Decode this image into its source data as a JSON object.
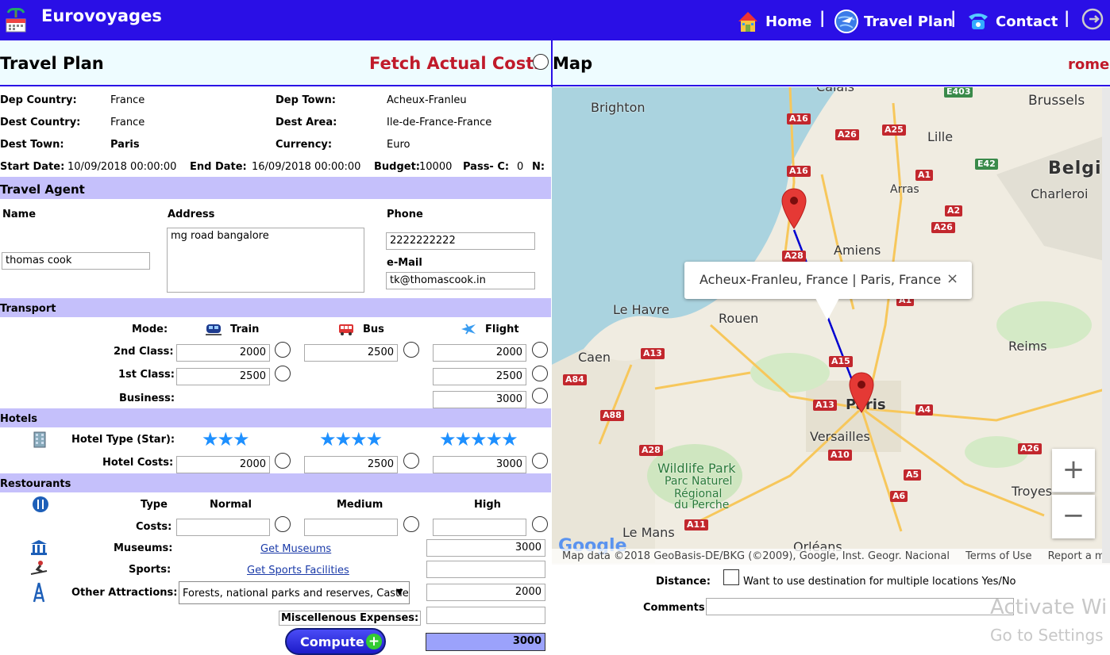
{
  "brand": "Eurovoyages",
  "nav": {
    "home": "Home",
    "travel_plan": "Travel Plan",
    "contact": "Contact",
    "sep": "|"
  },
  "left_head": {
    "title": "Travel Plan",
    "fetch": "Fetch Actual Costs"
  },
  "right_head": {
    "title": "Map",
    "error": "rome"
  },
  "trip": {
    "dep_country_label": "Dep Country:",
    "dep_country": "France",
    "dep_town_label": "Dep Town:",
    "dep_town": "Acheux-Franleu",
    "dest_country_label": "Dest Country:",
    "dest_country": "France",
    "dest_area_label": "Dest Area:",
    "dest_area": "Ile-de-France-France",
    "dest_town_label": "Dest Town:",
    "dest_town": "Paris",
    "currency_label": "Currency:",
    "currency": "Euro",
    "start_label": "Start Date:",
    "start": "10/09/2018 00:00:00",
    "end_label": "End Date:",
    "end": "16/09/2018 00:00:00",
    "budget_label": "Budget:",
    "budget": "10000",
    "pass_label": "Pass- C:",
    "pass": "0",
    "n_label": "N:"
  },
  "agent": {
    "section": "Travel Agent",
    "name_label": "Name",
    "name": "thomas cook",
    "address_label": "Address",
    "address": "mg road bangalore",
    "phone_label": "Phone",
    "phone": "2222222222",
    "email_label": "e-Mail",
    "email": "tk@thomascook.in"
  },
  "transport": {
    "section": "Transport",
    "mode_label": "Mode:",
    "train": "Train",
    "bus": "Bus",
    "flight": "Flight",
    "second_label": "2nd Class:",
    "first_label": "1st Class:",
    "business_label": "Business:",
    "train_2nd": "2000",
    "bus_2nd": "2500",
    "flight_2nd": "2000",
    "train_1st": "2500",
    "flight_1st": "2500",
    "flight_business": "3000"
  },
  "hotels": {
    "section": "Hotels",
    "type_label": "Hotel Type (Star):",
    "costs_label": "Hotel Costs:",
    "stars3": "★★★",
    "stars4": "★★★★",
    "stars5": "★★★★★",
    "cost3": "2000",
    "cost4": "2500",
    "cost5": "3000"
  },
  "restaurants": {
    "section": "Restourants",
    "type_label": "Type",
    "normal": "Normal",
    "medium": "Medium",
    "high": "High",
    "costs_label": "Costs:",
    "museums_label": "Museums:",
    "museums_link": "Get Museums",
    "museums_cost": "3000",
    "sports_label": "Sports:",
    "sports_link": "Get Sports Facilities",
    "other_label": "Other Attractions:",
    "other_value": "Forests, national parks and reserves, Castles",
    "other_cost": "2000",
    "misc_label": "Miscellenous Expenses:",
    "compute": "Compute",
    "total": "3000"
  },
  "map": {
    "popup": "Acheux-Franleu, France | Paris, France",
    "close": "×",
    "zoom_in": "+",
    "zoom_out": "−",
    "google": "Google",
    "attribution": "Map data ©2018 GeoBasis-DE/BKG (©2009), Google, Inst. Geogr. Nacional",
    "terms": "Terms of Use",
    "report": "Report a map error",
    "cities": [
      "Calais",
      "Brighton",
      "Brussels",
      "Lille",
      "Belgiu",
      "Arras",
      "Charleroi",
      "Amiens",
      "Le Havre",
      "Rouen",
      "Caen",
      "Reims",
      "Paris",
      "Versailles",
      "Wildlife Park",
      "Parc Naturel",
      "Régional",
      "du Perche",
      "Le Mans",
      "Orléans",
      "Troyes"
    ],
    "roads": [
      "E403",
      "A16",
      "A25",
      "A26",
      "A16",
      "A1",
      "E42",
      "A2",
      "A26",
      "A28",
      "A1",
      "A13",
      "A84",
      "A15",
      "A13",
      "A4",
      "A88",
      "A10",
      "A28",
      "A5",
      "A26",
      "A6",
      "A11"
    ]
  },
  "bottom": {
    "distance_label": "Distance:",
    "multi_label": "Want to use destination for multiple locations Yes/No",
    "comments_label": "Comments:",
    "watermark1": "Activate Wi",
    "watermark2": "Go to Settings"
  }
}
